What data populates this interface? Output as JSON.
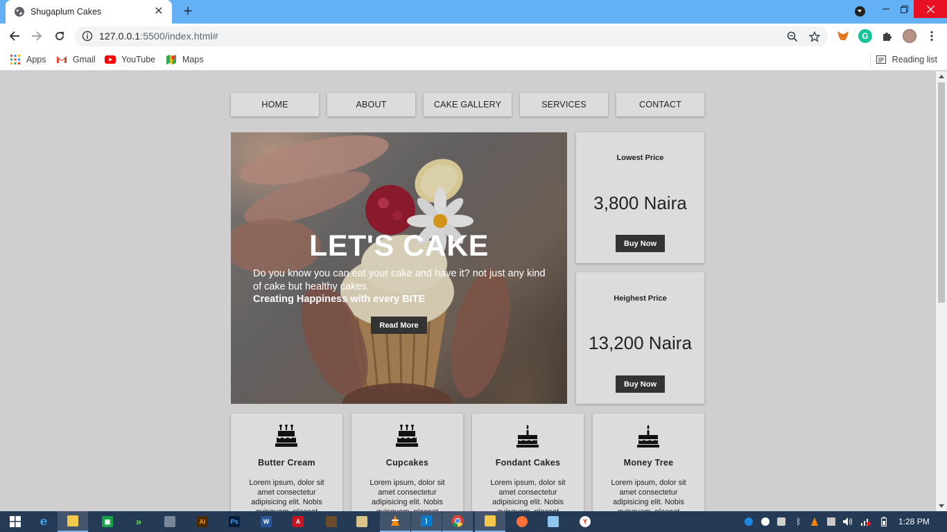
{
  "browser": {
    "tab_title": "Shugaplum Cakes",
    "url_host": "127.0.0.1",
    "url_rest": ":5500/index.html#",
    "bookmarks": [
      "Apps",
      "Gmail",
      "YouTube",
      "Maps"
    ],
    "reading_list": "Reading list"
  },
  "nav": {
    "items": [
      "HOME",
      "ABOUT",
      "CAKE GALLERY",
      "SERVICES",
      "CONTACT"
    ]
  },
  "hero": {
    "title": "LET'S CAKE",
    "text": "Do you know you can eat your cake and have it? not just any kind of cake but healthy cakes.",
    "tagline": "Creating Happiness with every BITE",
    "button": "Read More"
  },
  "prices": [
    {
      "label": "Lowest Price",
      "amount": "3,800 Naira",
      "button": "Buy Now"
    },
    {
      "label": "Heighest Price",
      "amount": "13,200 Naira",
      "button": "Buy Now"
    }
  ],
  "products": [
    {
      "title": "Butter Cream",
      "icon": "birthday-cake-icon",
      "text": "Lorem ipsum, dolor sit amet consectetur adipisicing elit. Nobis quisquam, placeat ipsam"
    },
    {
      "title": "Cupcakes",
      "icon": "birthday-cake-icon",
      "text": "Lorem ipsum, dolor sit amet consectetur adipisicing elit. Nobis quisquam, placeat ipsam"
    },
    {
      "title": "Fondant Cakes",
      "icon": "cake-candle-icon",
      "text": "Lorem ipsum, dolor sit amet consectetur adipisicing elit. Nobis quisquam, placeat ipsam"
    },
    {
      "title": "Money Tree",
      "icon": "cake-candle-icon",
      "text": "Lorem ipsum, dolor sit amet consectetur adipisicing elit. Nobis quisquam, placeat ipsam"
    }
  ],
  "taskbar": {
    "clock": "1:28 PM"
  },
  "colors": {
    "page_bg": "#cfcfcf",
    "card_bg": "#dcdcdc",
    "button_dark": "#333333",
    "tabbar": "#64b0f5",
    "taskbar": "#253a55"
  }
}
